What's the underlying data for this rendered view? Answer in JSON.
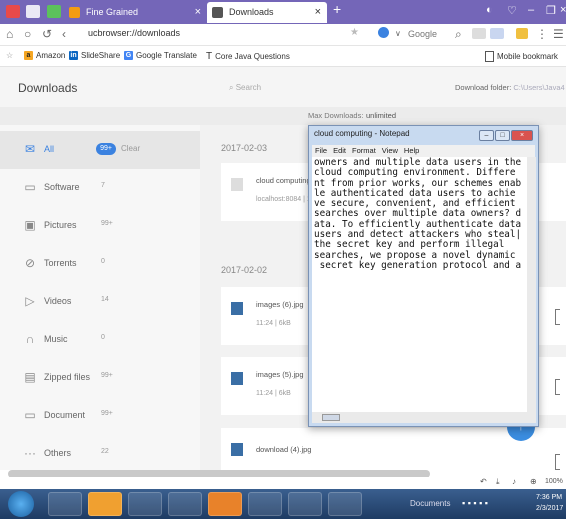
{
  "browser": {
    "tabs": [
      {
        "label": "Fine Grained",
        "active": false
      },
      {
        "label": "Downloads",
        "active": true
      }
    ],
    "url": "ucbrowser://downloads",
    "search_engine": "Google",
    "bookmarks": [
      "Amazon",
      "SlideShare",
      "Google Translate",
      "Core Java Questions"
    ],
    "mobile_bookmarks": "Mobile bookmark"
  },
  "downloads": {
    "title": "Downloads",
    "search_placeholder": "Search",
    "folder_label": "Download folder:",
    "folder_path": "C:\\Users\\Java4",
    "max_downloads_label": "Max Downloads:",
    "max_downloads_value": "unlimited"
  },
  "sidebar": {
    "items": [
      {
        "label": "All",
        "count": "99+",
        "icon": "mail-icon",
        "active": true
      },
      {
        "label": "Software",
        "count": "7",
        "icon": "window-icon"
      },
      {
        "label": "Pictures",
        "count": "99+",
        "icon": "image-icon"
      },
      {
        "label": "Torrents",
        "count": "0",
        "icon": "magnet-icon"
      },
      {
        "label": "Videos",
        "count": "14",
        "icon": "play-icon"
      },
      {
        "label": "Music",
        "count": "0",
        "icon": "headphones-icon"
      },
      {
        "label": "Zipped files",
        "count": "99+",
        "icon": "zip-icon"
      },
      {
        "label": "Document",
        "count": "99+",
        "icon": "folder-icon"
      },
      {
        "label": "Others",
        "count": "22",
        "icon": "dots-icon"
      }
    ],
    "clear_label": "Clear"
  },
  "main": {
    "groups": [
      {
        "date": "2017-02-03",
        "files": [
          {
            "name": "cloud computing.t",
            "meta": "localhost:8084 | 1!"
          }
        ]
      },
      {
        "date": "2017-02-02",
        "files": [
          {
            "name": "images (6).jpg",
            "meta": "11:24 | 6kB"
          },
          {
            "name": "images (5).jpg",
            "meta": "11:24 | 6kB"
          },
          {
            "name": "download (4).jpg",
            "meta": ""
          }
        ]
      }
    ]
  },
  "notepad": {
    "title": "cloud computing - Notepad",
    "menu": [
      "File",
      "Edit",
      "Format",
      "View",
      "Help"
    ],
    "text": "owners and multiple data users in the\ncloud computing environment. Differe\nnt from prior works, our schemes enab\nle authenticated data users to achie\nve secure, convenient, and efficient\nsearches over multiple data owners? d\nata. To efficiently authenticate data\nusers and detect attackers who steal|\nthe secret key and perform illegal\nsearches, we propose a novel dynamic\n secret key generation protocol and a"
  },
  "statusbar": {
    "zoom": "100%"
  },
  "taskbar": {
    "documents_label": "Documents",
    "time": "7:36 PM",
    "date": "2/3/2017"
  },
  "colors": {
    "titlebar": "#7466b8",
    "accent": "#3b82e0",
    "taskbar": "#2a4a75"
  }
}
